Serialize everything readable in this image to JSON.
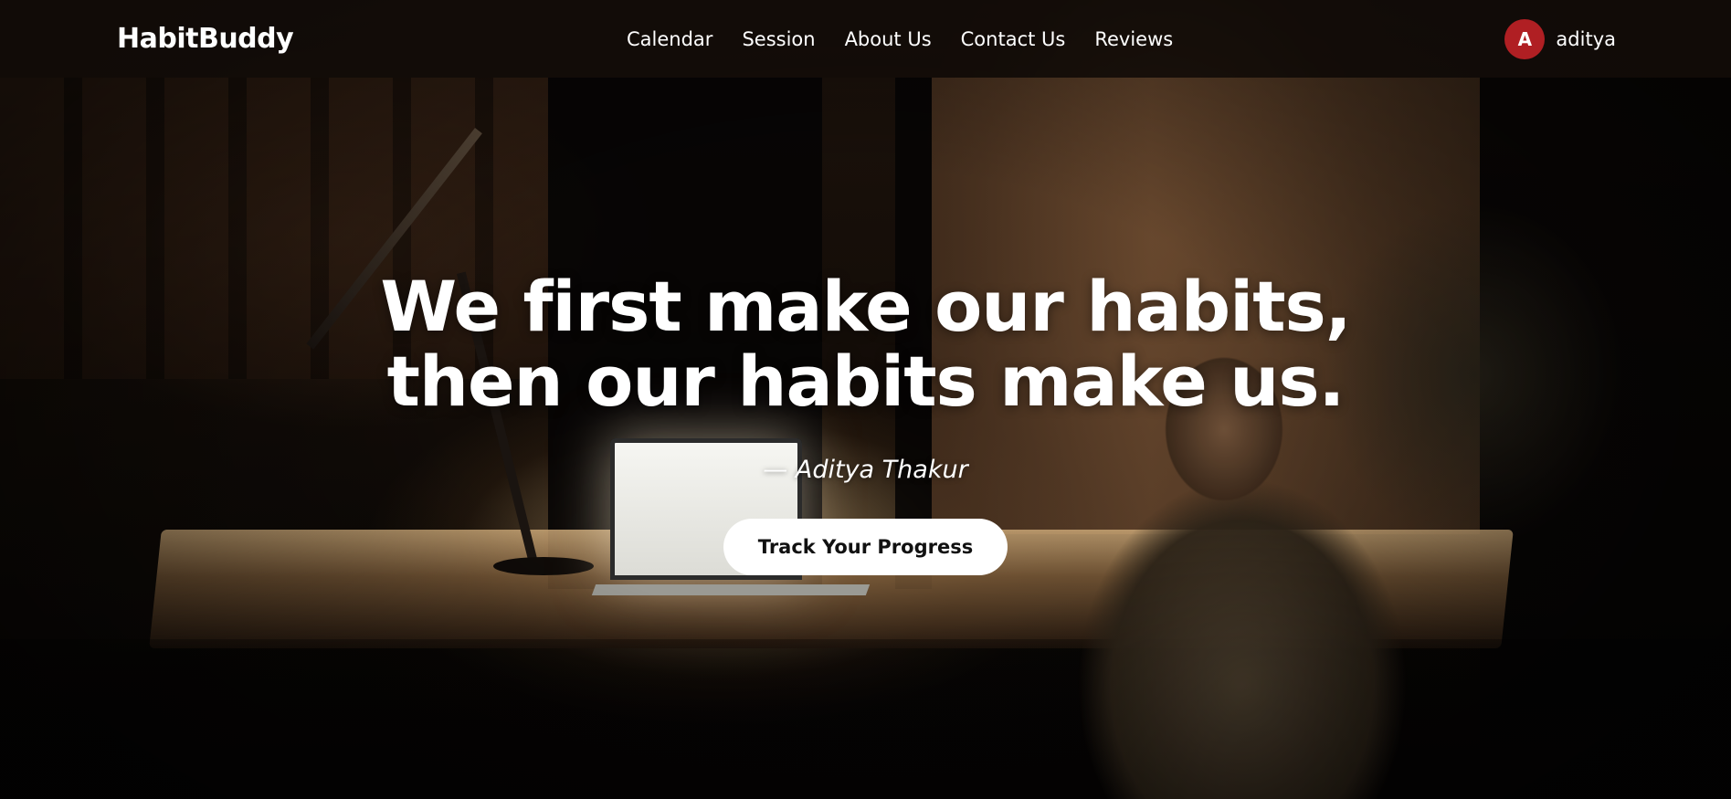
{
  "header": {
    "brand": "HabitBuddy",
    "nav": [
      {
        "label": "Calendar"
      },
      {
        "label": "Session"
      },
      {
        "label": "About Us"
      },
      {
        "label": "Contact Us"
      },
      {
        "label": "Reviews"
      }
    ],
    "user": {
      "avatar_initial": "A",
      "avatar_color": "#b01f23",
      "name": "aditya"
    }
  },
  "hero": {
    "quote_line1": "We first make our habits,",
    "quote_line2": "then our habits make us.",
    "author": "— Aditya Thakur",
    "cta_label": "Track Your Progress"
  }
}
